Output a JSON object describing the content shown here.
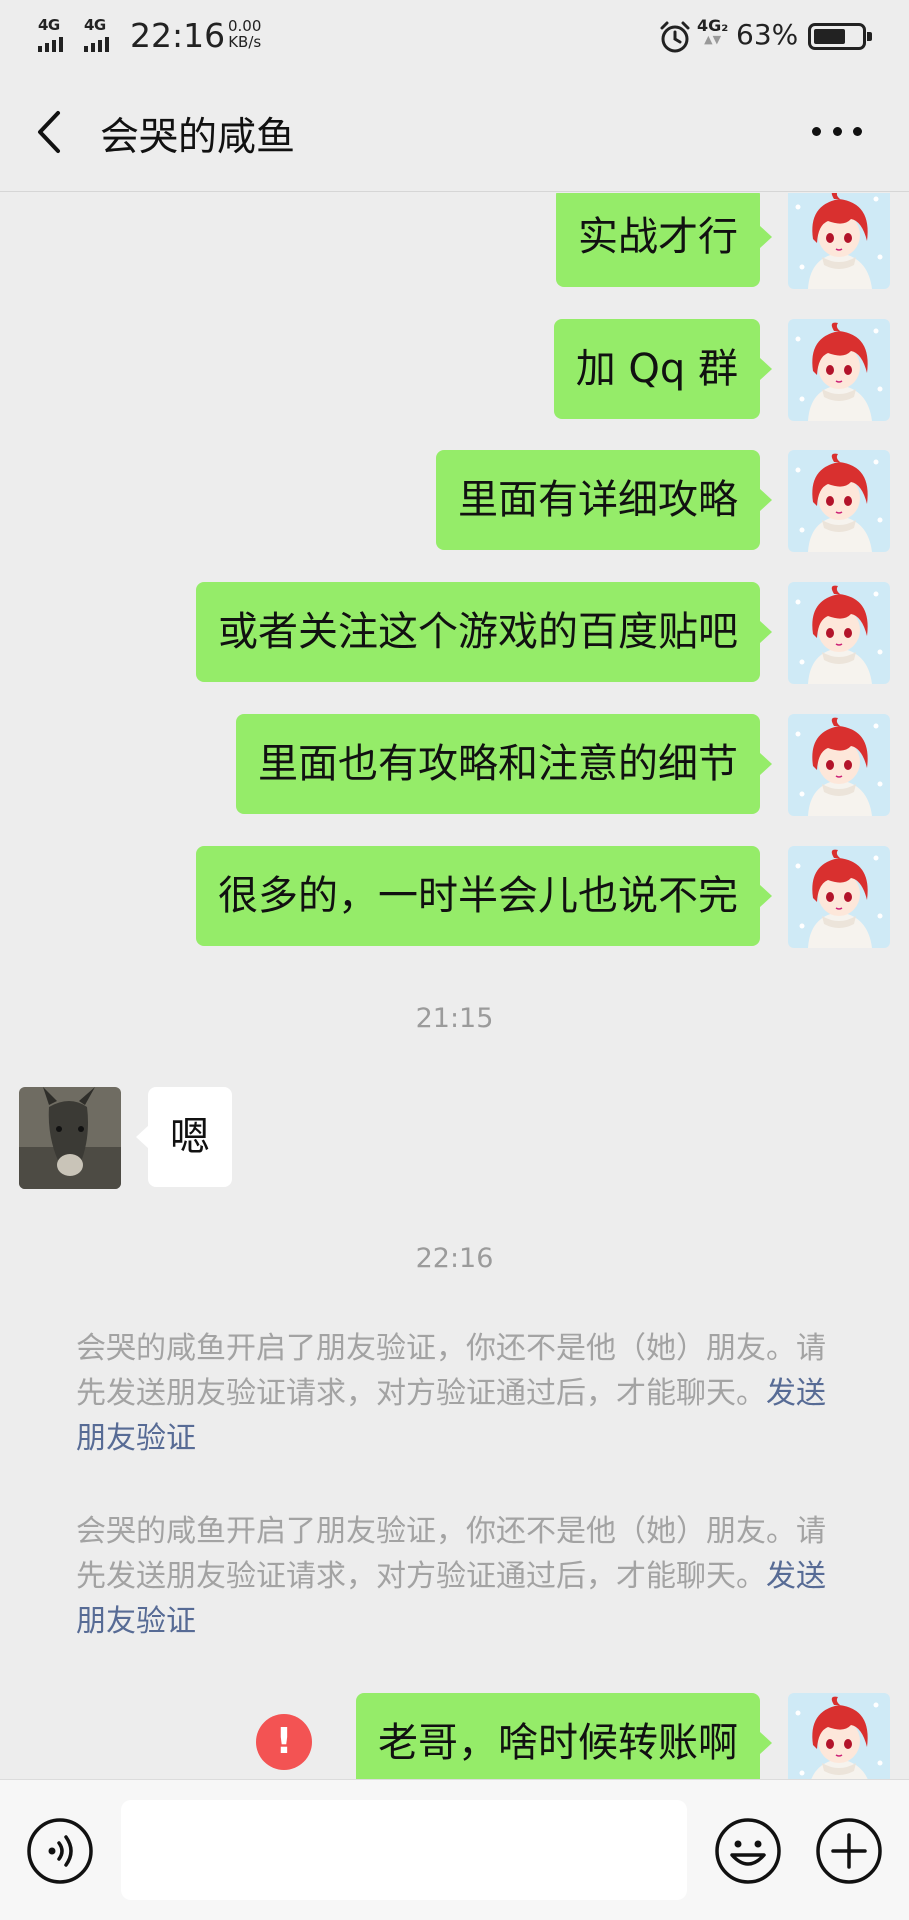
{
  "status_bar": {
    "sim1_net": "4G",
    "sim2_net": "4G",
    "time": "22:16",
    "speed_value": "0.00",
    "speed_unit": "KB/s",
    "sim_badge": "4G₂",
    "battery_percent": "63%",
    "battery_level": 0.63
  },
  "header": {
    "back_icon": "chevron-left",
    "title": "会哭的咸鱼",
    "more_icon": "more-dots"
  },
  "messages": [
    {
      "type": "outgoing",
      "text": "实战才行"
    },
    {
      "type": "outgoing",
      "text": "加 Qq 群"
    },
    {
      "type": "outgoing",
      "text": "里面有详细攻略"
    },
    {
      "type": "outgoing",
      "text": "或者关注这个游戏的百度贴吧"
    },
    {
      "type": "outgoing",
      "text": "里面也有攻略和注意的细节"
    },
    {
      "type": "outgoing",
      "text": "很多的，一时半会儿也说不完"
    },
    {
      "type": "time",
      "text": "21:15"
    },
    {
      "type": "incoming",
      "text": "嗯"
    },
    {
      "type": "time",
      "text": "22:16"
    },
    {
      "type": "system",
      "text": "会哭的咸鱼开启了朋友验证，你还不是他（她）朋友。请先发送朋友验证请求，对方验证通过后，才能聊天。",
      "link": "发送朋友验证"
    },
    {
      "type": "system",
      "text": "会哭的咸鱼开启了朋友验证，你还不是他（她）朋友。请先发送朋友验证请求，对方验证通过后，才能聊天。",
      "link": "发送朋友验证"
    },
    {
      "type": "outgoing",
      "text": "老哥，啥时候转账啊",
      "failed": true,
      "error_icon": "!"
    }
  ],
  "input_bar": {
    "voice_icon": "voice-icon",
    "text_value": "",
    "emoji_icon": "emoji-icon",
    "plus_icon": "plus-icon"
  },
  "colors": {
    "background": "#ededed",
    "outgoing_bubble": "#95ec69",
    "incoming_bubble": "#ffffff",
    "system_text": "#a3a3a3",
    "link": "#576b95",
    "error": "#f35353"
  }
}
